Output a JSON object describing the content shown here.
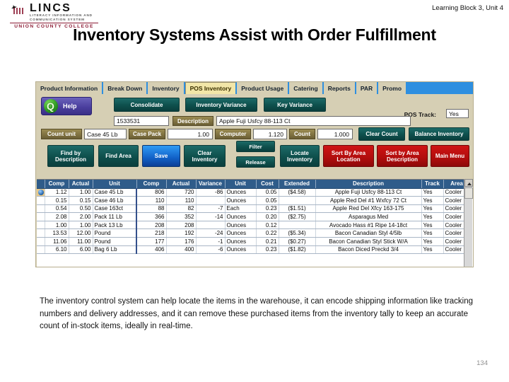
{
  "slide": {
    "logo": {
      "brand": "LINCS",
      "tagline": "LITERACY INFORMATION AND COMMUNICATION SYSTEM",
      "institution": "UNION COUNTY COLLEGE"
    },
    "learning_block": "Learning Block 3, Unit 4",
    "title": "Inventory Systems Assist with Order Fulfillment",
    "body": "The inventory control system can help locate the items in the warehouse, it can encode shipping information like tracking numbers and delivery addresses, and it can remove these purchased items from the inventory tally to keep an accurate count of in-stock items, ideally in real-time.",
    "page_number": "134"
  },
  "app": {
    "tabs": [
      {
        "label": "Product Information",
        "active": false
      },
      {
        "label": "Break Down",
        "active": false
      },
      {
        "label": "Inventory",
        "active": false
      },
      {
        "label": "POS Inventory",
        "active": true
      },
      {
        "label": "Product Usage",
        "active": false
      },
      {
        "label": "Catering",
        "active": false
      },
      {
        "label": "Reports",
        "active": false
      },
      {
        "label": "PAR",
        "active": false
      },
      {
        "label": "Promo",
        "active": false
      }
    ],
    "help_button": "Help",
    "top_buttons": [
      {
        "label": "Consolidate"
      },
      {
        "label": "Inventory Variance"
      },
      {
        "label": "Key Variance"
      }
    ],
    "pos_track_label": "POS Track:",
    "pos_track_value": "Yes",
    "item_code": "1533531",
    "description_label": "Description",
    "description_value": "Apple Fuji Usfcy 88-113 Ct",
    "count_unit_label": "Count unit",
    "count_unit_value": "Case 45 Lb",
    "case_pack_label": "Case Pack",
    "case_pack_value": "1.00",
    "computer_label": "Computer",
    "computer_value": "1.120",
    "count_label": "Count",
    "count_value": "1.000",
    "clear_count_button": "Clear Count",
    "balance_inventory_button": "Balance Inventory",
    "action_buttons": [
      {
        "label": "Find by Description",
        "style": "teal"
      },
      {
        "label": "Find Area",
        "style": "teal"
      },
      {
        "label": "Save",
        "style": "blue"
      },
      {
        "label": "Clear Inventory",
        "style": "teal"
      },
      {
        "label": "Filter",
        "style": "teal"
      },
      {
        "label": "Release",
        "style": "teal"
      },
      {
        "label": "Locate Inventory",
        "style": "teal"
      },
      {
        "label": "Sort By Area Location",
        "style": "red"
      },
      {
        "label": "Sort by Area Description",
        "style": "red"
      },
      {
        "label": "Main Menu",
        "style": "red"
      }
    ],
    "grid": {
      "columns": [
        "Comp",
        "Actual",
        "Unit",
        "Comp",
        "Actual",
        "Variance",
        "Unit",
        "Cost",
        "Extended",
        "Description",
        "Track",
        "Area"
      ],
      "rows": [
        {
          "comp1": "1.12",
          "actual1": "1.00",
          "unit1": "Case 45 Lb",
          "comp2": "806",
          "actual2": "720",
          "variance": "-86",
          "unit2": "Ounces",
          "cost": "0.05",
          "extended": "($4.58)",
          "description": "Apple Fuji Usfcy 88-113 Ct",
          "track": "Yes",
          "area": "Cooler",
          "selected": true
        },
        {
          "comp1": "0.15",
          "actual1": "0.15",
          "unit1": "Case 46 Lb",
          "comp2": "110",
          "actual2": "110",
          "variance": "",
          "unit2": "Ounces",
          "cost": "0.05",
          "extended": "",
          "description": "Apple Red Del #1 Wxfcy 72 Ct",
          "track": "Yes",
          "area": "Cooler",
          "selected": false
        },
        {
          "comp1": "0.54",
          "actual1": "0.50",
          "unit1": "Case 163ct",
          "comp2": "88",
          "actual2": "82",
          "variance": "-7",
          "unit2": "Each",
          "cost": "0.23",
          "extended": "($1.51)",
          "description": "Apple Red Del Xfcy 163-175",
          "track": "Yes",
          "area": "Cooler",
          "selected": false
        },
        {
          "comp1": "2.08",
          "actual1": "2.00",
          "unit1": "Pack 11 Lb",
          "comp2": "366",
          "actual2": "352",
          "variance": "-14",
          "unit2": "Ounces",
          "cost": "0.20",
          "extended": "($2.75)",
          "description": "Asparagus Med",
          "track": "Yes",
          "area": "Cooler",
          "selected": false
        },
        {
          "comp1": "1.00",
          "actual1": "1.00",
          "unit1": "Pack 13 Lb",
          "comp2": "208",
          "actual2": "208",
          "variance": "",
          "unit2": "Ounces",
          "cost": "0.12",
          "extended": "",
          "description": "Avocado Hass #1 Ripe 14-18ct",
          "track": "Yes",
          "area": "Cooler",
          "selected": false
        },
        {
          "comp1": "13.53",
          "actual1": "12.00",
          "unit1": "Pound",
          "comp2": "218",
          "actual2": "192",
          "variance": "-24",
          "unit2": "Ounces",
          "cost": "0.22",
          "extended": "($5.34)",
          "description": "Bacon Canadian Styl 4/5lb",
          "track": "Yes",
          "area": "Cooler",
          "selected": false
        },
        {
          "comp1": "11.06",
          "actual1": "11.00",
          "unit1": "Pound",
          "comp2": "177",
          "actual2": "176",
          "variance": "-1",
          "unit2": "Ounces",
          "cost": "0.21",
          "extended": "($0.27)",
          "description": "Bacon Canadian Styl Stick W/A",
          "track": "Yes",
          "area": "Cooler",
          "selected": false
        },
        {
          "comp1": "6.10",
          "actual1": "6.00",
          "unit1": "Bag 6 Lb",
          "comp2": "406",
          "actual2": "400",
          "variance": "-6",
          "unit2": "Ounces",
          "cost": "0.23",
          "extended": "($1.82)",
          "description": "Bacon Diced Preckd 3/4",
          "track": "Yes",
          "area": "Cooler",
          "selected": false
        }
      ]
    }
  },
  "colors": {
    "app_background": "#d6cfb4",
    "tab_active": "#f2e6a8",
    "tab_bar": "#2e8fe0",
    "teal_button": "#0e4f4c",
    "red_button": "#b00d0d",
    "blue_button": "#1160c7",
    "grid_header": "#2f5c8a",
    "brand_maroon": "#8c1d36"
  }
}
